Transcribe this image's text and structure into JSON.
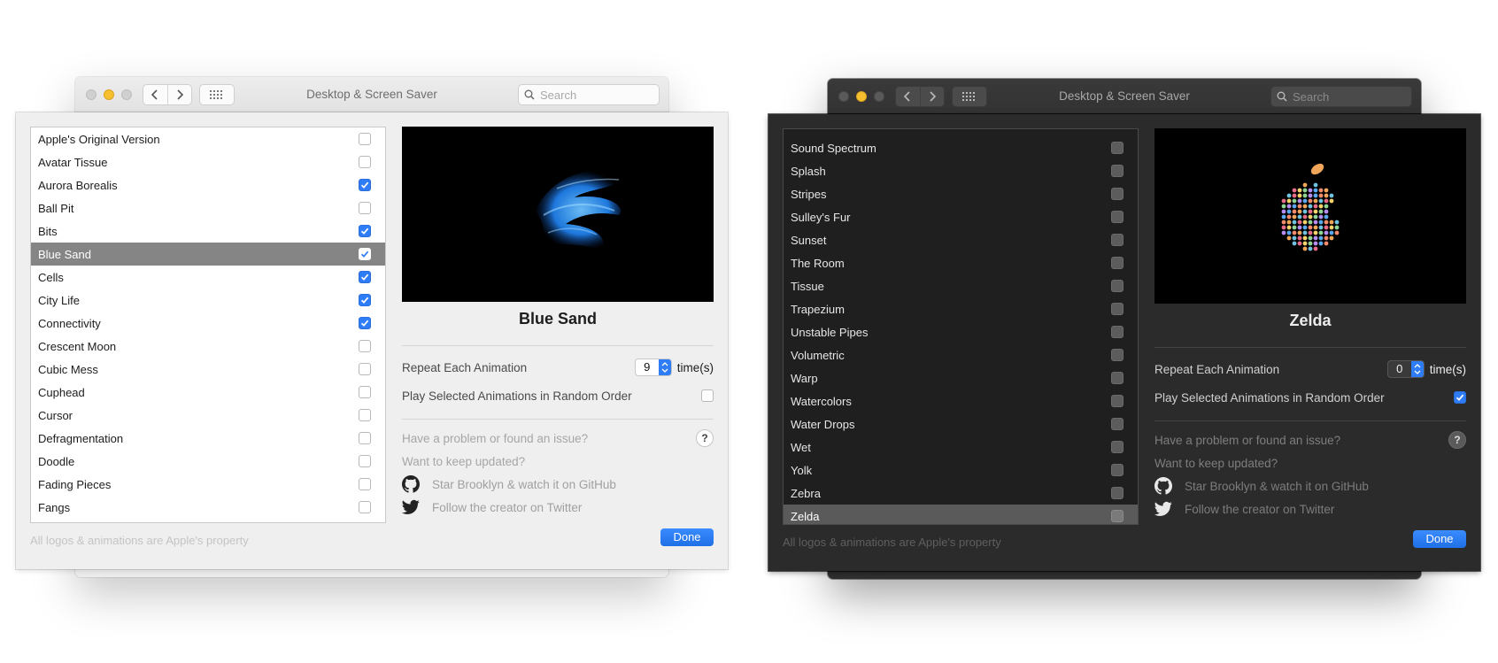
{
  "light": {
    "window_title": "Desktop & Screen Saver",
    "search_placeholder": "Search",
    "list": [
      {
        "label": "Apple's Original Version",
        "checked": false,
        "selected": false
      },
      {
        "label": "Avatar Tissue",
        "checked": false,
        "selected": false
      },
      {
        "label": "Aurora Borealis",
        "checked": true,
        "selected": false
      },
      {
        "label": "Ball Pit",
        "checked": false,
        "selected": false
      },
      {
        "label": "Bits",
        "checked": true,
        "selected": false
      },
      {
        "label": "Blue Sand",
        "checked": true,
        "selected": true
      },
      {
        "label": "Cells",
        "checked": true,
        "selected": false
      },
      {
        "label": "City Life",
        "checked": true,
        "selected": false
      },
      {
        "label": "Connectivity",
        "checked": true,
        "selected": false
      },
      {
        "label": "Crescent Moon",
        "checked": false,
        "selected": false
      },
      {
        "label": "Cubic Mess",
        "checked": false,
        "selected": false
      },
      {
        "label": "Cuphead",
        "checked": false,
        "selected": false
      },
      {
        "label": "Cursor",
        "checked": false,
        "selected": false
      },
      {
        "label": "Defragmentation",
        "checked": false,
        "selected": false
      },
      {
        "label": "Doodle",
        "checked": false,
        "selected": false
      },
      {
        "label": "Fading Pieces",
        "checked": false,
        "selected": false
      },
      {
        "label": "Fangs",
        "checked": false,
        "selected": false
      }
    ],
    "preview_title": "Blue Sand",
    "repeat_label": "Repeat Each Animation",
    "repeat_value": "9",
    "repeat_unit": "time(s)",
    "random_label": "Play Selected Animations in Random Order",
    "random_checked": false,
    "problem_text": "Have a problem or found an issue?",
    "help_glyph": "?",
    "updates_text": "Want to keep updated?",
    "github_text": "Star Brooklyn & watch it on GitHub",
    "twitter_text": "Follow the creator on Twitter",
    "footer_note": "All logos & animations are Apple's property",
    "done_label": "Done"
  },
  "dark": {
    "window_title": "Desktop & Screen Saver",
    "search_placeholder": "Search",
    "list": [
      {
        "label": "Sound Spectrum",
        "checked": false,
        "selected": false
      },
      {
        "label": "Splash",
        "checked": false,
        "selected": false
      },
      {
        "label": "Stripes",
        "checked": false,
        "selected": false
      },
      {
        "label": "Sulley's Fur",
        "checked": false,
        "selected": false
      },
      {
        "label": "Sunset",
        "checked": false,
        "selected": false
      },
      {
        "label": "The Room",
        "checked": false,
        "selected": false
      },
      {
        "label": "Tissue",
        "checked": false,
        "selected": false
      },
      {
        "label": "Trapezium",
        "checked": false,
        "selected": false
      },
      {
        "label": "Unstable Pipes",
        "checked": false,
        "selected": false
      },
      {
        "label": "Volumetric",
        "checked": false,
        "selected": false
      },
      {
        "label": "Warp",
        "checked": false,
        "selected": false
      },
      {
        "label": "Watercolors",
        "checked": false,
        "selected": false
      },
      {
        "label": "Water Drops",
        "checked": false,
        "selected": false
      },
      {
        "label": "Wet",
        "checked": false,
        "selected": false
      },
      {
        "label": "Yolk",
        "checked": false,
        "selected": false
      },
      {
        "label": "Zebra",
        "checked": false,
        "selected": false
      },
      {
        "label": "Zelda",
        "checked": false,
        "selected": true
      }
    ],
    "preview_title": "Zelda",
    "repeat_label": "Repeat Each Animation",
    "repeat_value": "0",
    "repeat_unit": "time(s)",
    "random_label": "Play Selected Animations in Random Order",
    "random_checked": true,
    "problem_text": "Have a problem or found an issue?",
    "help_glyph": "?",
    "updates_text": "Want to keep updated?",
    "github_text": "Star Brooklyn & watch it on GitHub",
    "twitter_text": "Follow the creator on Twitter",
    "footer_note": "All logos & animations are Apple's property",
    "done_label": "Done"
  },
  "colors": {
    "accent": "#2f7df6",
    "selected_row_light": "#858585",
    "selected_row_dark": "#5a5a5a",
    "traffic_yellow": "#f5bf2f"
  },
  "icons": {
    "nav_back": "chevron-left-icon",
    "nav_forward": "chevron-right-icon",
    "grid": "grid-icon",
    "search": "search-icon",
    "github": "github-icon",
    "twitter": "twitter-icon",
    "checkmark": "checkmark-icon"
  }
}
